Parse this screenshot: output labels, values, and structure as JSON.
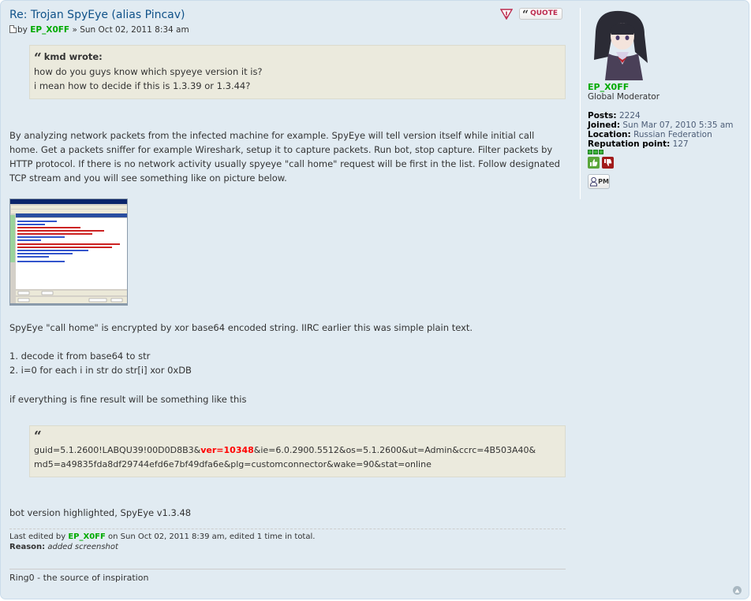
{
  "post": {
    "title": "Re: Trojan SpyEye (alias Pincav)",
    "by_label": "by",
    "author": "EP_X0FF",
    "date_sep": "»",
    "date": "Sun Oct 02, 2011 8:34 am",
    "quote_button_label": "QUOTE"
  },
  "quote1": {
    "cite": "kmd wrote:",
    "lines": [
      "how do you guys know which spyeye version it is?",
      "i mean how to decide if this is 1.3.39 or 1.3.44?"
    ]
  },
  "body": {
    "para1": "By analyzing network packets from the infected machine for example. SpyEye will tell version itself while initial call home. Get a packets sniffer for example Wireshark, setup it to capture packets. Run bot, stop capture. Filter packets by HTTP protocol. If there is no network activity usually spyeye \"call home\" request will be first in the list. Follow designated TCP stream and you will see something like on picture below.",
    "para2": "SpyEye \"call home\" is encrypted by xor base64 encoded string. IIRC earlier this was simple plain text.",
    "step1": "1. decode it from base64 to str",
    "step2": "2. i=0 for each i in str do str[i] xor 0xDB",
    "para3": "if everything is fine result will be something like this",
    "para4": "bot version highlighted, SpyEye v1.3.48"
  },
  "quote2": {
    "before": "guid=5.1.2600!LABQU39!00D0D8B3&",
    "highlight": "ver=10348",
    "after": "&ie=6.0.2900.5512&os=5.1.2600&ut=Admin&ccrc=4B503A40&",
    "line2": "md5=a49835fda8df29744efd6e7bf49dfa6e&plg=customconnector&wake=90&stat=online"
  },
  "notice": {
    "prefix": "Last edited by",
    "author": "EP_X0FF",
    "suffix": "on Sun Oct 02, 2011 8:39 am, edited 1 time in total.",
    "reason_label": "Reason:",
    "reason": "added screenshot"
  },
  "signature": "Ring0 - the source of inspiration",
  "profile": {
    "name": "EP_X0FF",
    "rank": "Global Moderator",
    "posts_label": "Posts:",
    "posts": "2224",
    "joined_label": "Joined:",
    "joined": "Sun Mar 07, 2010 5:35 am",
    "location_label": "Location:",
    "location": "Russian Federation",
    "reputation_label": "Reputation point:",
    "reputation": "127",
    "reputation_bar_level": 3,
    "pm_label": "PM"
  },
  "colors": {
    "username": "#00aa00",
    "title": "#105289",
    "highlight": "#ff0000",
    "background": "#e1ebf2",
    "quote_bg": "#ebeadd"
  },
  "icons": [
    "post-icon",
    "report-icon",
    "quote-icon",
    "rate-up-icon",
    "rate-down-icon",
    "pm-icon",
    "back-to-top-icon"
  ]
}
